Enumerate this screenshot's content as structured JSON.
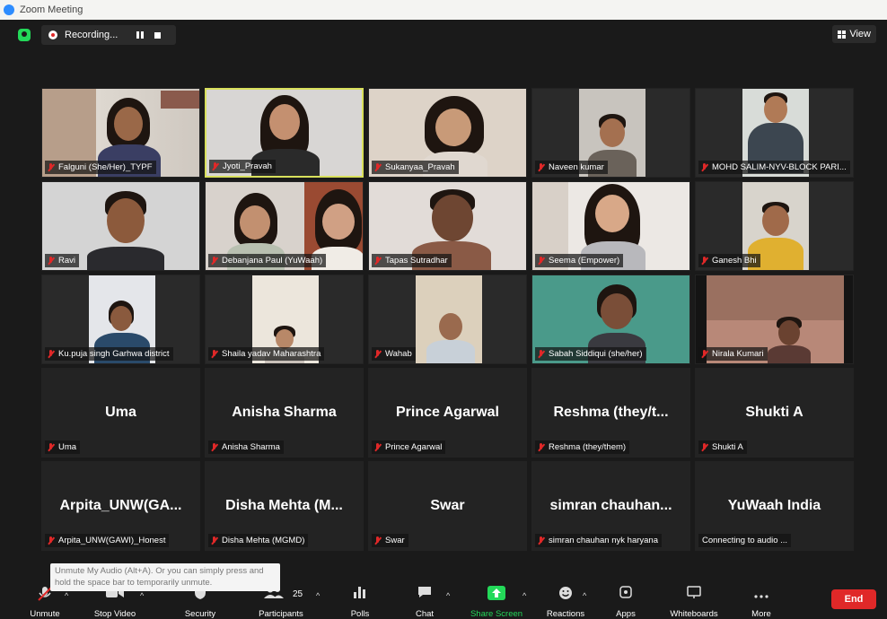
{
  "window": {
    "title": "Zoom Meeting"
  },
  "topbar": {
    "recording_label": "Recording...",
    "view_label": "View"
  },
  "participants": [
    {
      "label": "Falguni (She/Her)_TYPF"
    },
    {
      "label": "Jyoti_Pravah"
    },
    {
      "label": "Sukanyaa_Pravah"
    },
    {
      "label": "Naveen kumar"
    },
    {
      "label": "MOHD SALIM-NYV-BLOCK PARI..."
    },
    {
      "label": "Ravi"
    },
    {
      "label": "Debanjana Paul (YuWaah)"
    },
    {
      "label": "Tapas Sutradhar"
    },
    {
      "label": "Seema (Empower)"
    },
    {
      "label": "Ganesh Bhi"
    },
    {
      "label": "Ku.puja singh Garhwa district"
    },
    {
      "label": "Shaila yadav Maharashtra"
    },
    {
      "label": "Wahab"
    },
    {
      "label": "Sabah Siddiqui (she/her)"
    },
    {
      "label": "Nirala Kumari"
    },
    {
      "display": "Uma",
      "label": "Uma"
    },
    {
      "display": "Anisha Sharma",
      "label": "Anisha Sharma"
    },
    {
      "display": "Prince Agarwal",
      "label": "Prince Agarwal"
    },
    {
      "display": "Reshma  (they/t...",
      "label": "Reshma (they/them)"
    },
    {
      "display": "Shukti A",
      "label": "Shukti A"
    },
    {
      "display": "Arpita_UNW(GA...",
      "label": "Arpita_UNW(GAWI)_Honest"
    },
    {
      "display": "Disha  Mehta  (M...",
      "label": "Disha Mehta (MGMD)"
    },
    {
      "display": "Swar",
      "label": "Swar"
    },
    {
      "display": "simran  chauhan...",
      "label": "simran chauhan nyk haryana"
    },
    {
      "display": "YuWaah India",
      "label": "Connecting to audio ..."
    }
  ],
  "tooltip": {
    "text": "Unmute My Audio (Alt+A). Or you can simply press and hold the space bar to temporarily unmute."
  },
  "toolbar": {
    "unmute": "Unmute",
    "stop_video": "Stop Video",
    "security": "Security",
    "participants": "Participants",
    "participant_count": "25",
    "polls": "Polls",
    "chat": "Chat",
    "share_screen": "Share Screen",
    "reactions": "Reactions",
    "apps": "Apps",
    "whiteboards": "Whiteboards",
    "more": "More",
    "end": "End"
  },
  "colors": {
    "share_green": "#23d959",
    "end_red": "#e02828",
    "active_speaker": "#d8e05c",
    "muted_red": "#e02828"
  }
}
